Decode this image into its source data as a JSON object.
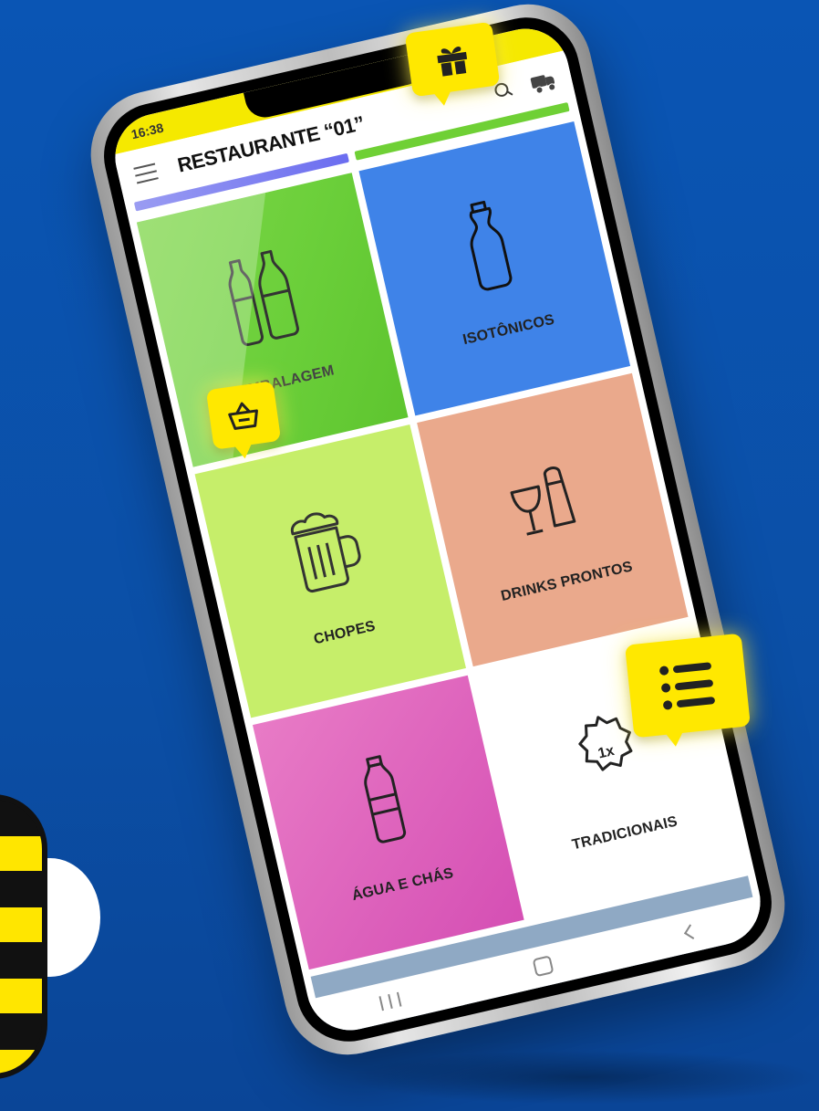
{
  "status_bar": {
    "time": "16:38"
  },
  "app_bar": {
    "title": "RESTAURANTE “01”"
  },
  "icons": {
    "menu": "hamburger-menu-icon",
    "search": "search-icon",
    "delivery": "truck-icon",
    "gift": "gift-icon",
    "basket": "basket-icon",
    "list": "list-icon"
  },
  "categories": [
    {
      "label": "EMBALAGEM",
      "icon": "bottles-icon",
      "color": "#6bcf3a"
    },
    {
      "label": "ISOTÔNICOS",
      "icon": "sports-bottle-icon",
      "color": "#3f83e8"
    },
    {
      "label": "CHOPES",
      "icon": "beer-mug-icon",
      "color": "#c6ee6a"
    },
    {
      "label": "DRINKS PRONTOS",
      "icon": "glasses-icon",
      "color": "#eaa98c"
    },
    {
      "label": "ÁGUA E CHÁS",
      "icon": "water-bottle-icon",
      "color": "#d54fb4"
    },
    {
      "label": "TRADICIONAIS",
      "icon": "1x-badge-icon",
      "color": "#ffffff",
      "badge_text": "1x"
    }
  ],
  "colors": {
    "background": "#0a55b4",
    "badge_yellow": "#ffe800",
    "status_bar": "#f5e900"
  }
}
